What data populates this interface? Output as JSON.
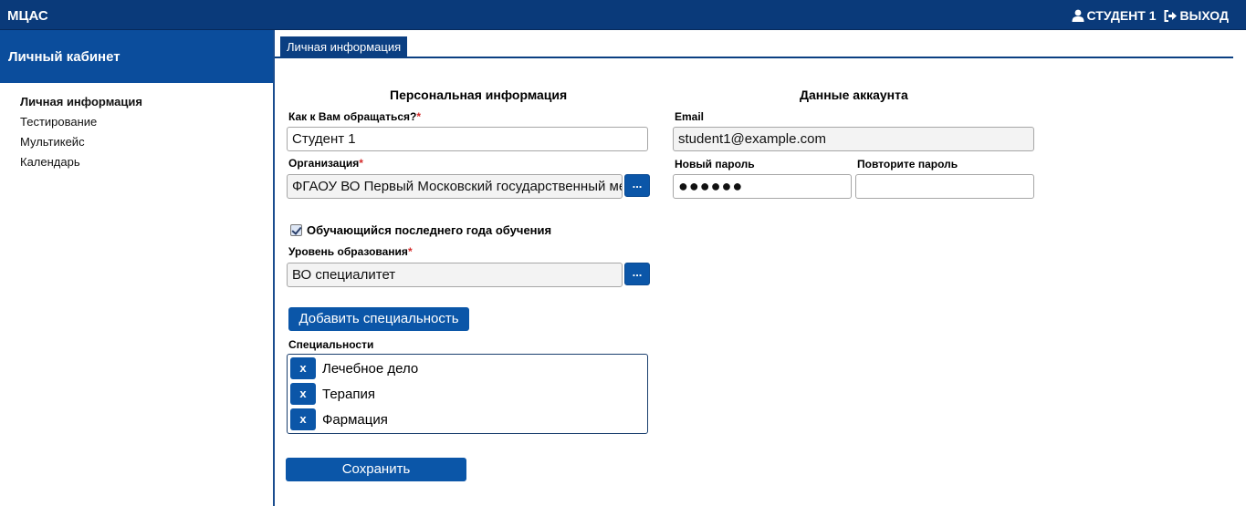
{
  "app": {
    "title": "МЦАС"
  },
  "user": {
    "name": "СТУДЕНТ 1",
    "logout": "ВЫХОД"
  },
  "sidebar": {
    "title": "Личный кабинет",
    "items": [
      {
        "label": "Личная информация",
        "active": true
      },
      {
        "label": "Тестирование",
        "active": false
      },
      {
        "label": "Мультикейс",
        "active": false
      },
      {
        "label": "Календарь",
        "active": false
      }
    ]
  },
  "tabs": [
    {
      "label": "Личная информация",
      "active": true
    }
  ],
  "personal": {
    "title": "Персональная информация",
    "name_label": "Как к Вам обращаться?",
    "name_value": "Студент 1",
    "org_label": "Организация",
    "org_value": "ФГАОУ ВО Первый Московский государственный медицинский университет",
    "dots": "...",
    "final_year_label": "Обучающийся последнего года обучения",
    "final_year_checked": true,
    "edu_label": "Уровень образования",
    "edu_value": "ВО специалитет",
    "add_spec_button": "Добавить специальность",
    "specs_label": "Специальности",
    "specialties": [
      {
        "remove": "x",
        "name": "Лечебное дело"
      },
      {
        "remove": "x",
        "name": "Терапия"
      },
      {
        "remove": "x",
        "name": "Фармация"
      }
    ],
    "save_button": "Сохранить",
    "required_mark": "*"
  },
  "account": {
    "title": "Данные аккаунта",
    "email_label": "Email",
    "email_value": "student1@example.com",
    "new_password_label": "Новый пароль",
    "new_password_value": "●●●●●●",
    "repeat_password_label": "Повторите пароль",
    "repeat_password_value": ""
  },
  "colors": {
    "topbar": "#0a3a7a",
    "accent": "#0b56a8",
    "required": "#d42a2a"
  }
}
